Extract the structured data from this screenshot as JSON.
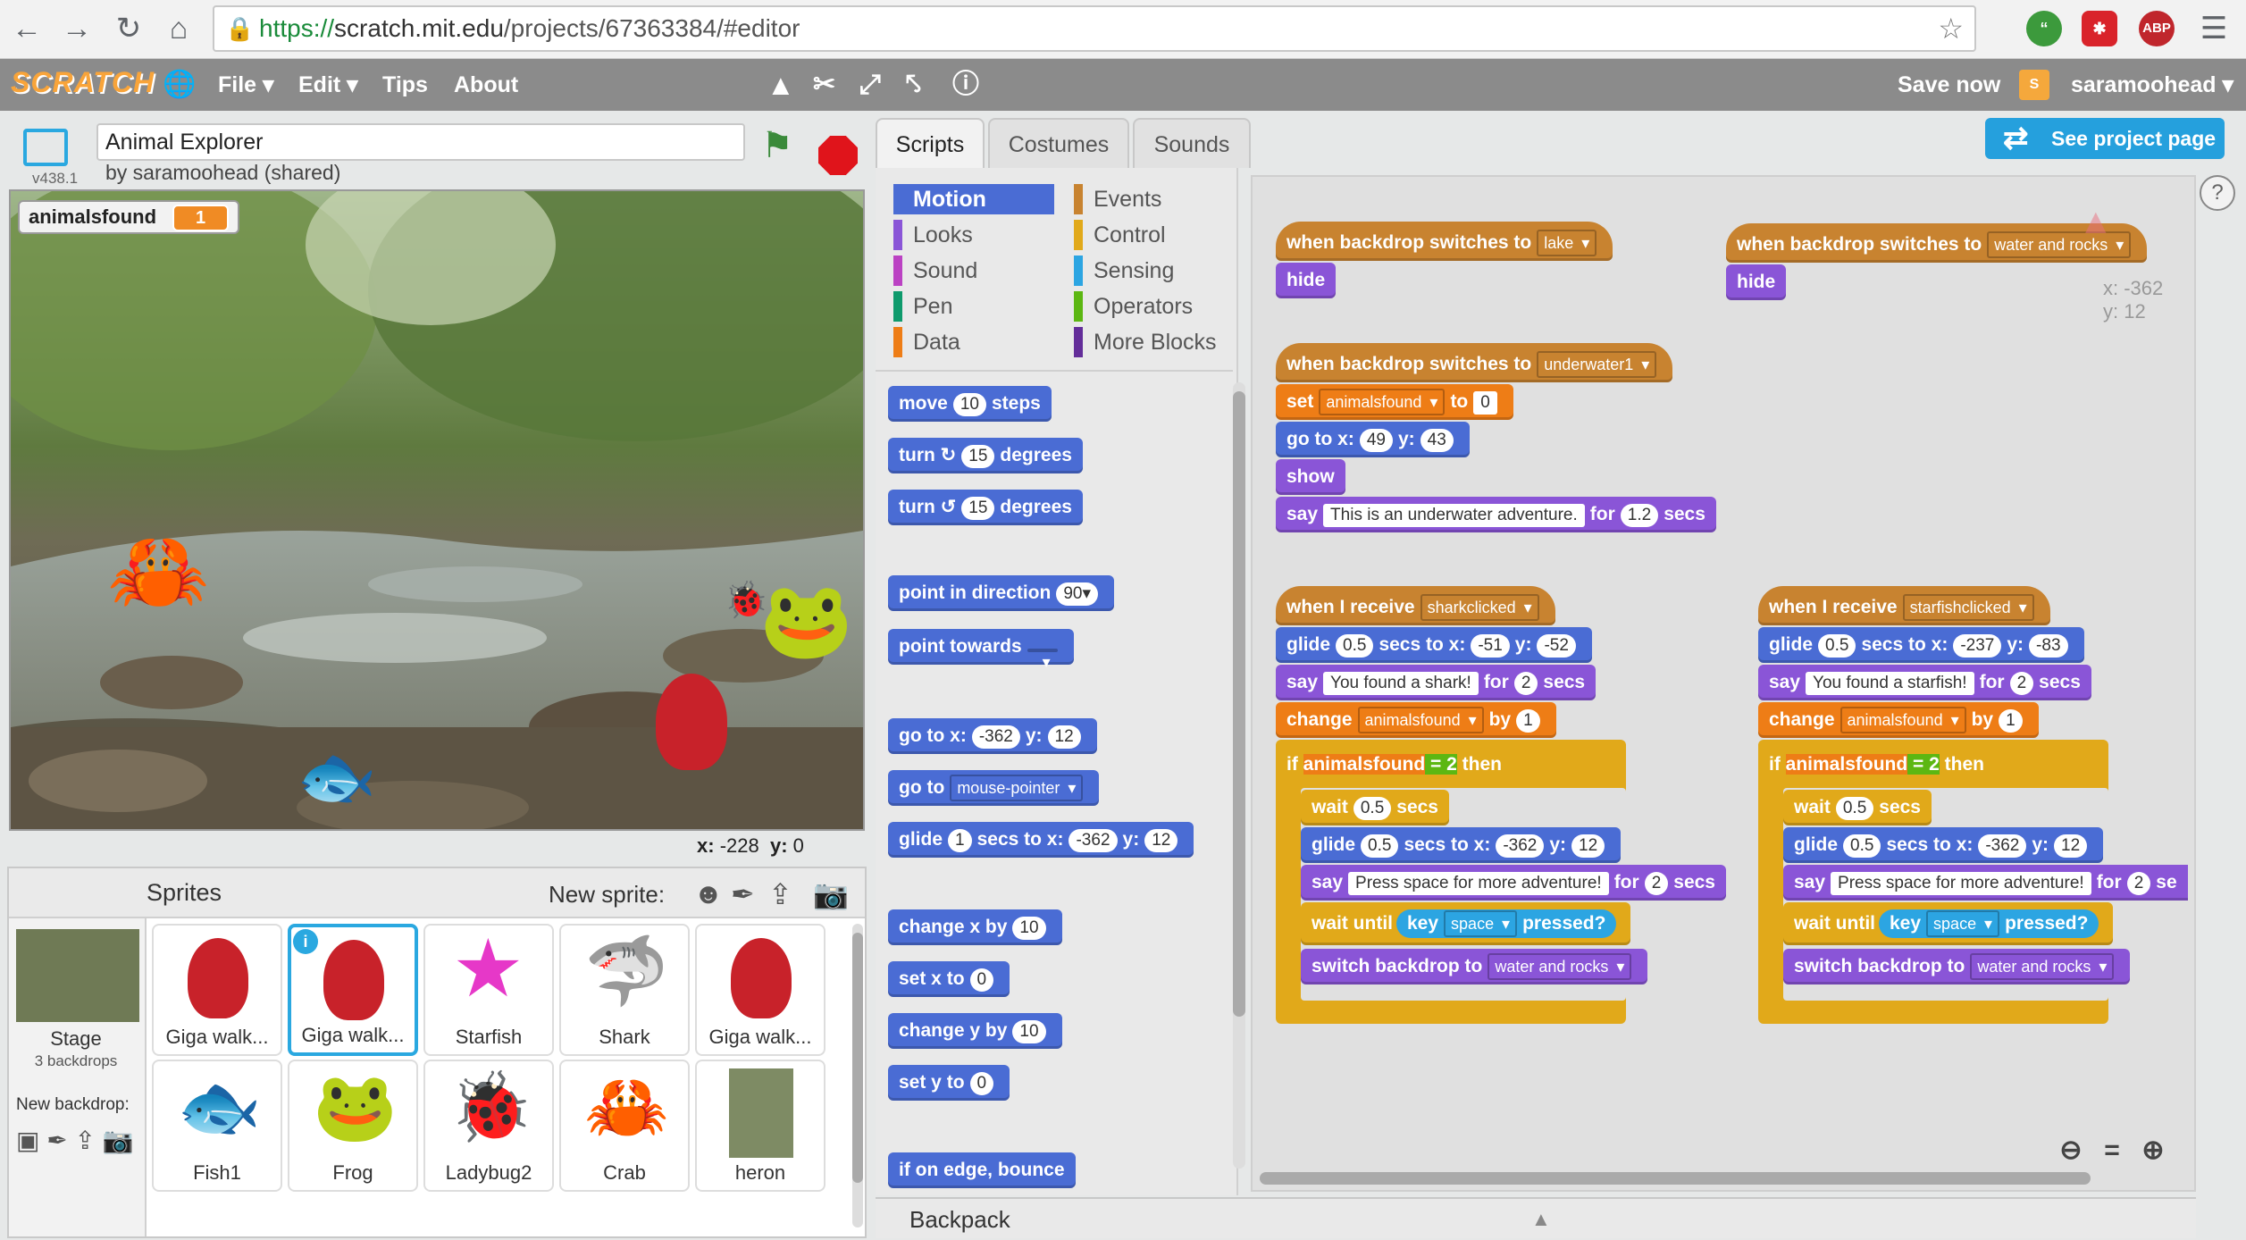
{
  "browser": {
    "url_scheme": "https://",
    "url_host": "scratch.mit.edu",
    "url_path": "/projects/67363384/#editor",
    "ext_abp": "ABP"
  },
  "menubar": {
    "logo": "SCRATCH",
    "file": "File ▾",
    "edit": "Edit ▾",
    "tips": "Tips",
    "about": "About",
    "save_now": "Save now",
    "username": "saramoohead ▾"
  },
  "stage": {
    "version": "v438.1",
    "project_title": "Animal Explorer",
    "byline": "by saramoohead (shared)",
    "monitor_label": "animalsfound",
    "monitor_value": "1",
    "coords_x_label": "x:",
    "coords_x": "-228",
    "coords_y_label": "y:",
    "coords_y": "0"
  },
  "sprites_pane": {
    "title": "Sprites",
    "new_sprite": "New sprite:",
    "stage_label": "Stage",
    "stage_backdrops": "3 backdrops",
    "new_backdrop": "New backdrop:",
    "sprites": [
      {
        "name": "Giga walk..."
      },
      {
        "name": "Giga walk..."
      },
      {
        "name": "Starfish"
      },
      {
        "name": "Shark"
      },
      {
        "name": "Giga walk..."
      },
      {
        "name": "Fish1"
      },
      {
        "name": "Frog"
      },
      {
        "name": "Ladybug2"
      },
      {
        "name": "Crab"
      },
      {
        "name": "heron"
      }
    ]
  },
  "tabs": [
    "Scripts",
    "Costumes",
    "Sounds"
  ],
  "see_project_page": "See project page",
  "categories": {
    "motion": "Motion",
    "looks": "Looks",
    "sound": "Sound",
    "pen": "Pen",
    "data": "Data",
    "events": "Events",
    "control": "Control",
    "sensing": "Sensing",
    "operators": "Operators",
    "more": "More Blocks"
  },
  "palette": {
    "move": "move",
    "move_n": "10",
    "steps": "steps",
    "turn": "turn",
    "turn_n": "15",
    "degrees": "degrees",
    "point_dir": "point in direction",
    "point_dir_v": "90▾",
    "point_towards": "point towards",
    "goto": "go to x:",
    "goto_x": "-362",
    "goto_y_l": "y:",
    "goto_y": "12",
    "goto_to": "go to",
    "goto_target": "mouse-pointer",
    "glide": "glide",
    "glide_s": "1",
    "glide_secs": "secs to x:",
    "glide_x": "-362",
    "glide_y": "12",
    "change_x": "change x by",
    "change_x_v": "10",
    "set_x": "set x to",
    "set_x_v": "0",
    "change_y": "change y by",
    "change_y_v": "10",
    "set_y": "set y to",
    "set_y_v": "0",
    "bounce": "if on edge, bounce"
  },
  "scripts": {
    "s1_hat": "when backdrop switches to",
    "s1_dd": "lake",
    "s1_hide": "hide",
    "s2_hat": "when backdrop switches to",
    "s2_dd": "water and rocks",
    "s2_hide": "hide",
    "s3_hat": "when backdrop switches to",
    "s3_dd": "underwater1",
    "s3_set": "set",
    "s3_var": "animalsfound",
    "s3_to": "to",
    "s3_val": "0",
    "s3_goto": "go to x:",
    "s3_x": "49",
    "s3_yl": "y:",
    "s3_y": "43",
    "s3_show": "show",
    "s3_say": "say",
    "s3_msg": "This is an underwater adventure.",
    "s3_for": "for",
    "s3_secs_v": "1.2",
    "s3_secs": "secs",
    "sel_x_label": "x: -362",
    "sel_y_label": "y: 12",
    "shark": {
      "hat": "when I receive",
      "msg": "sharkclicked",
      "glide": "glide",
      "g_s": "0.5",
      "g_secs": "secs to x:",
      "g_x": "-51",
      "g_yl": "y:",
      "g_y": "-52",
      "say": "say",
      "say_msg": "You found a shark!",
      "for": "for",
      "say_s": "2",
      "secs": "secs",
      "change": "change",
      "var": "animalsfound",
      "by": "by",
      "by_v": "1",
      "if": "if",
      "cmp_var": "animalsfound",
      "eq": "=",
      "cmp_v": "2",
      "then": "then",
      "wait": "wait",
      "wait_v": "0.5",
      "wait_secs": "secs",
      "glide2": "glide",
      "g2_s": "0.5",
      "g2_secs": "secs to x:",
      "g2_x": "-362",
      "g2_yl": "y:",
      "g2_y": "12",
      "say2": "say",
      "say2_msg": "Press space for more adventure!",
      "for2": "for",
      "say2_s": "2",
      "secs2": "secs",
      "wait_until": "wait until",
      "key": "key",
      "key_v": "space",
      "pressed": "pressed?",
      "switch": "switch backdrop to",
      "switch_v": "water and rocks"
    },
    "star": {
      "hat": "when I receive",
      "msg": "starfishclicked",
      "glide": "glide",
      "g_s": "0.5",
      "g_secs": "secs to x:",
      "g_x": "-237",
      "g_yl": "y:",
      "g_y": "-83",
      "say": "say",
      "say_msg": "You found a starfish!",
      "for": "for",
      "say_s": "2",
      "secs": "secs",
      "change": "change",
      "var": "animalsfound",
      "by": "by",
      "by_v": "1",
      "if": "if",
      "cmp_var": "animalsfound",
      "eq": "=",
      "cmp_v": "2",
      "then": "then",
      "wait": "wait",
      "wait_v": "0.5",
      "wait_secs": "secs",
      "glide2": "glide",
      "g2_s": "0.5",
      "g2_secs": "secs to x:",
      "g2_x": "-362",
      "g2_yl": "y:",
      "g2_y": "12",
      "say2": "say",
      "say2_msg": "Press space for more adventure!",
      "for2": "for",
      "say2_s": "2",
      "secs2": "se",
      "wait_until": "wait until",
      "key": "key",
      "key_v": "space",
      "pressed": "pressed?",
      "switch": "switch backdrop to",
      "switch_v": "water and rocks"
    }
  },
  "backpack": "Backpack",
  "colors": {
    "motion": "#4a6cd4",
    "looks": "#8a55d7",
    "sound": "#bb42c3",
    "pen": "#0e9a6c",
    "data": "#ee7d16",
    "events": "#c88330",
    "control": "#e1a91a",
    "sensing": "#2ca5e2",
    "operators": "#5cb712",
    "more": "#632d99",
    "accent": "#25a0dd"
  }
}
